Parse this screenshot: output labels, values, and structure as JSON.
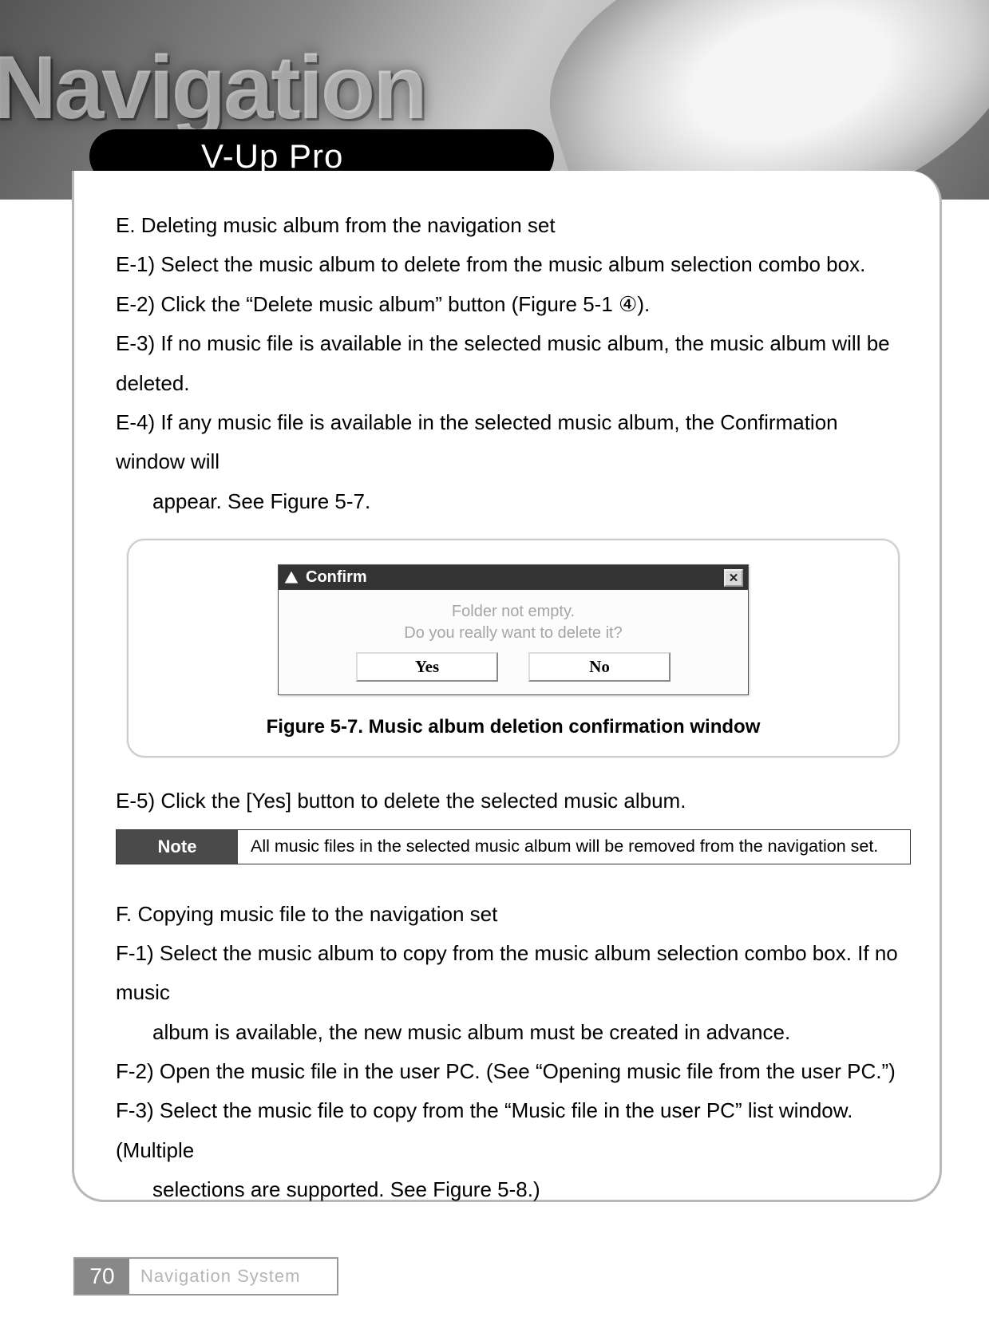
{
  "header": {
    "title": "Navigation",
    "subtitle": "V-Up Pro"
  },
  "sectionE": {
    "heading": "E. Deleting music album from the navigation set",
    "items": {
      "e1": "E-1) Select the music album to delete from the music album selection combo box.",
      "e2": "E-2) Click the “Delete music album” button (Figure 5-1 ④).",
      "e3": "E-3) If no music file is available in the selected music album, the music album will be deleted.",
      "e4a": "E-4) If any music file is available in the selected music album, the Confirmation window will",
      "e4b": "appear. See Figure 5-7.",
      "e5": "E-5) Click the [Yes] button to delete the selected music album."
    }
  },
  "dialog": {
    "title": "Confirm",
    "msg1": "Folder not empty.",
    "msg2": "Do you really want to delete it?",
    "yes": "Yes",
    "no": "No",
    "close": "✕"
  },
  "figure_caption": "Figure 5-7. Music album deletion confirmation window",
  "note": {
    "label": "Note",
    "text": "All music files in the selected music album will be removed from the navigation set."
  },
  "sectionF": {
    "heading": "F. Copying music file to the navigation set",
    "items": {
      "f1a": "F-1) Select the music album to copy from the music album selection combo box. If no music",
      "f1b": "album is available, the new music album must be created in advance.",
      "f2": "F-2) Open the music file in the user PC. (See “Opening music file from the user PC.”)",
      "f3a": "F-3) Select the music file to copy from the “Music file in the user PC” list window. (Multiple",
      "f3b": "selections are supported. See Figure 5-8.)"
    }
  },
  "footer": {
    "page": "70",
    "label": "Navigation System"
  }
}
